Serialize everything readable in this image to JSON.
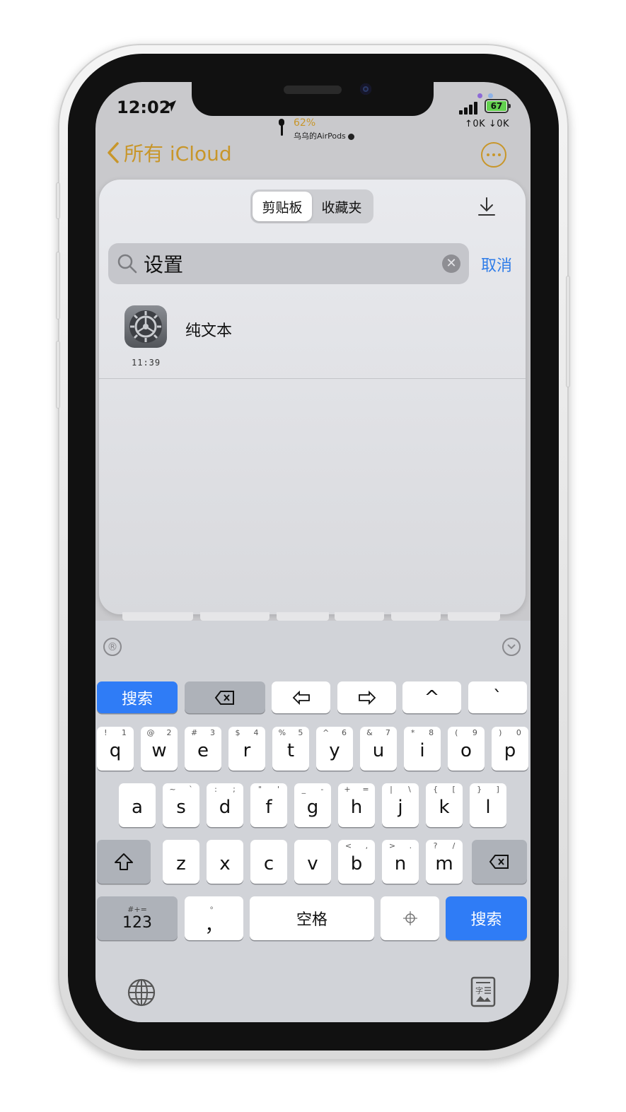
{
  "status": {
    "time": "12:02",
    "battery": "67",
    "net_speed": "↑0K ↓0K",
    "airpods_pct": "62%",
    "airpods_name": "乌乌的AirPods"
  },
  "nav": {
    "back_label": "所有 iCloud"
  },
  "panel": {
    "tabs": [
      "剪贴板",
      "收藏夹"
    ],
    "selected_tab": "剪贴板",
    "search_value": "设置",
    "cancel_label": "取消",
    "items": [
      {
        "title": "纯文本",
        "time": "11:39",
        "icon": "settings-app-icon"
      }
    ]
  },
  "keyboard": {
    "toolbar_left": "®",
    "top_row": [
      "搜索",
      "⌫",
      "⇦",
      "⇨",
      "^",
      "`"
    ],
    "rows": [
      [
        {
          "k": "q",
          "s": [
            "!",
            "1"
          ]
        },
        {
          "k": "w",
          "s": [
            "@",
            "2"
          ]
        },
        {
          "k": "e",
          "s": [
            "#",
            "3"
          ]
        },
        {
          "k": "r",
          "s": [
            "$",
            "4"
          ]
        },
        {
          "k": "t",
          "s": [
            "%",
            "5"
          ]
        },
        {
          "k": "y",
          "s": [
            "^",
            "6"
          ]
        },
        {
          "k": "u",
          "s": [
            "&",
            "7"
          ]
        },
        {
          "k": "i",
          "s": [
            "*",
            "8"
          ]
        },
        {
          "k": "o",
          "s": [
            "(",
            "9"
          ]
        },
        {
          "k": "p",
          "s": [
            ")",
            "0"
          ]
        }
      ],
      [
        {
          "k": "a",
          "s": []
        },
        {
          "k": "s",
          "s": [
            "~",
            "`"
          ]
        },
        {
          "k": "d",
          "s": [
            ":",
            ";"
          ]
        },
        {
          "k": "f",
          "s": [
            "\"",
            "'"
          ]
        },
        {
          "k": "g",
          "s": [
            "_",
            "-"
          ]
        },
        {
          "k": "h",
          "s": [
            "+",
            "="
          ]
        },
        {
          "k": "j",
          "s": [
            "|",
            "\\"
          ]
        },
        {
          "k": "k",
          "s": [
            "{",
            "["
          ]
        },
        {
          "k": "l",
          "s": [
            "}",
            "]"
          ]
        }
      ],
      [
        {
          "k": "z",
          "s": []
        },
        {
          "k": "x",
          "s": []
        },
        {
          "k": "c",
          "s": []
        },
        {
          "k": "v",
          "s": []
        },
        {
          "k": "b",
          "s": [
            "<",
            ","
          ]
        },
        {
          "k": "n",
          "s": [
            ">",
            "."
          ]
        },
        {
          "k": "m",
          "s": [
            "?",
            "/"
          ]
        }
      ]
    ],
    "num_key_sub": "#+=",
    "num_key": "123",
    "comma_key": "，",
    "comma_sub": "。",
    "space_key": "空格",
    "search_key": "搜索"
  },
  "colors": {
    "accent_gold": "#c8962a",
    "link_blue": "#2f7ce8",
    "key_blue": "#2f7cf6"
  }
}
